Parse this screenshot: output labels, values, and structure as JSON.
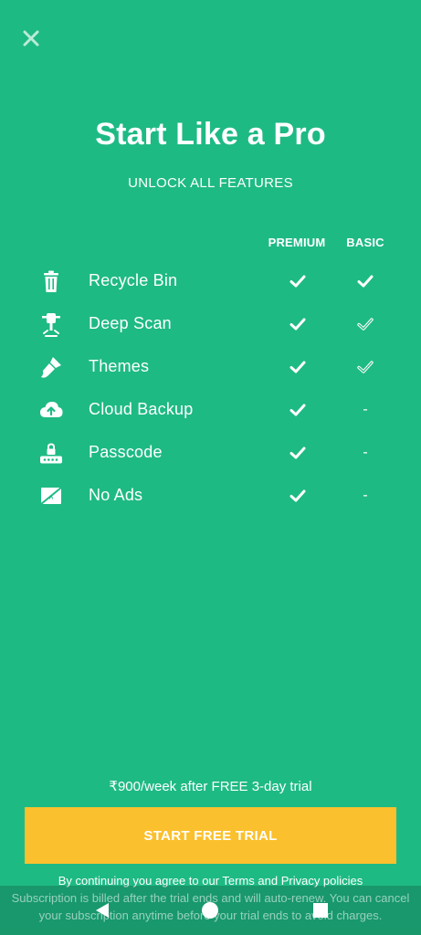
{
  "header": {
    "title": "Start Like a Pro",
    "subtitle": "UNLOCK ALL FEATURES"
  },
  "table": {
    "columns": [
      "PREMIUM",
      "BASIC"
    ],
    "rows": [
      {
        "label": "Recycle Bin",
        "icon": "trash-icon",
        "premium": "check",
        "basic": "check"
      },
      {
        "label": "Deep Scan",
        "icon": "drill-icon",
        "premium": "check",
        "basic": "check-outline"
      },
      {
        "label": "Themes",
        "icon": "brush-icon",
        "premium": "check",
        "basic": "check-outline"
      },
      {
        "label": "Cloud Backup",
        "icon": "cloud-upload-icon",
        "premium": "check",
        "basic": "-"
      },
      {
        "label": "Passcode",
        "icon": "lock-keypad-icon",
        "premium": "check",
        "basic": "-"
      },
      {
        "label": "No Ads",
        "icon": "no-ads-icon",
        "premium": "check",
        "basic": "-"
      }
    ]
  },
  "footer": {
    "price_note": "₹900/week after FREE 3-day trial",
    "cta_label": "START FREE TRIAL",
    "agree_text": "By continuing you agree to our Terms and Privacy policies",
    "billing_text": "Subscription is billed after the trial ends and will auto-renew. You can cancel your subscription anytime before your trial ends to avoid charges."
  },
  "colors": {
    "background": "#1EBA84",
    "cta": "#FBC02D",
    "text": "#FFFFFF"
  }
}
